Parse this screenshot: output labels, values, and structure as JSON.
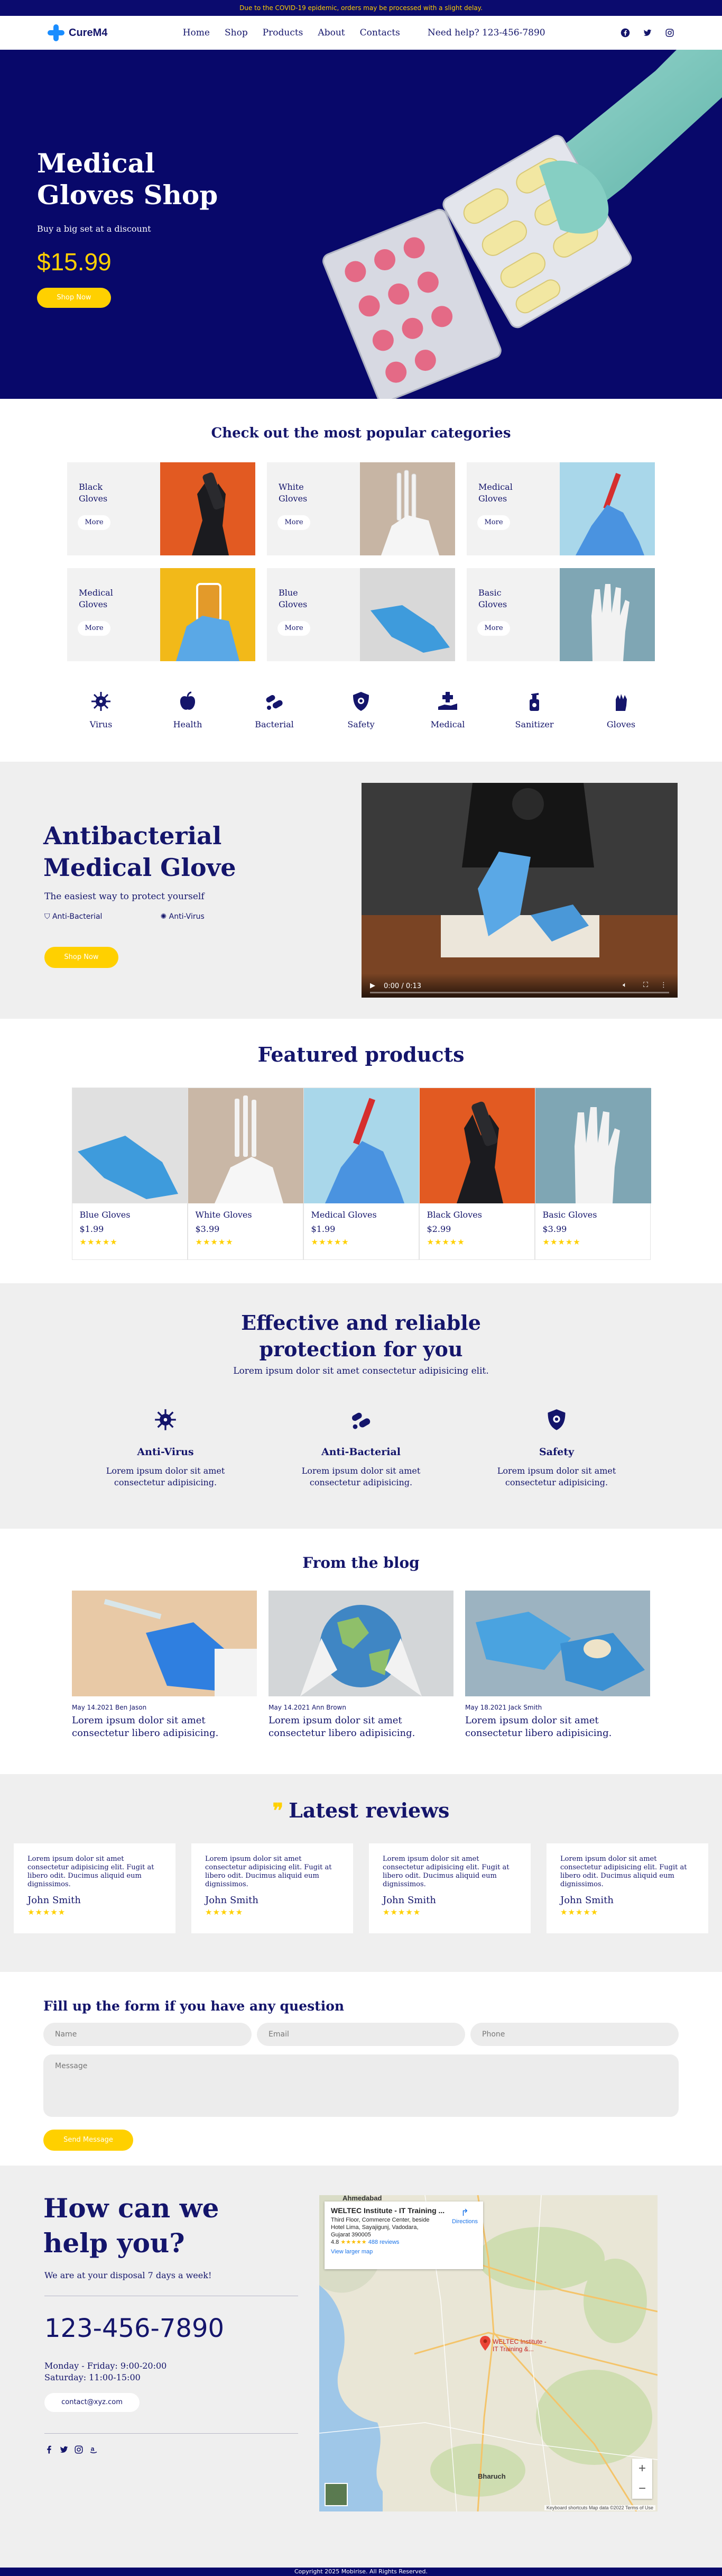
{
  "topbar": {
    "notice": "Due to the COVID-19 epidemic, orders may be processed with a slight delay."
  },
  "nav": {
    "logo": "CureM4",
    "items": [
      "Home",
      "Shop",
      "Products",
      "About",
      "Contacts"
    ],
    "phone": "Need help? 123-456-7890",
    "social_icons": [
      "facebook-icon",
      "twitter-icon",
      "instagram-icon"
    ]
  },
  "hero": {
    "title_line1": "Medical",
    "title_line2": "Gloves Shop",
    "subtitle": "Buy a big set at a discount",
    "price": "$15.99",
    "button": "Shop Now"
  },
  "categories": {
    "title": "Check out the most popular categories",
    "more_label": "More",
    "items": [
      {
        "line1": "Black",
        "line2": "Gloves"
      },
      {
        "line1": "White",
        "line2": "Gloves"
      },
      {
        "line1": "Medical",
        "line2": "Gloves"
      },
      {
        "line1": "Medical",
        "line2": "Gloves"
      },
      {
        "line1": "Blue",
        "line2": "Gloves"
      },
      {
        "line1": "Basic",
        "line2": "Gloves"
      }
    ],
    "icons": [
      {
        "label": "Virus",
        "icon": "virus-icon"
      },
      {
        "label": "Health",
        "icon": "apple-icon"
      },
      {
        "label": "Bacterial",
        "icon": "bacteria-icon"
      },
      {
        "label": "Safety",
        "icon": "shield-virus-icon"
      },
      {
        "label": "Medical",
        "icon": "hand-medical-icon"
      },
      {
        "label": "Sanitizer",
        "icon": "sanitizer-icon"
      },
      {
        "label": "Gloves",
        "icon": "glove-icon"
      }
    ]
  },
  "antibacterial": {
    "title_line1": "Antibacterial",
    "title_line2": "Medical Glove",
    "subtitle": "The easiest way to protect yourself",
    "feature1": "Anti-Bacterial",
    "feature2": "Anti-Virus",
    "button": "Shop Now",
    "video_time": "0:00 / 0:13"
  },
  "featured": {
    "title": "Featured products",
    "products": [
      {
        "name": "Blue Gloves",
        "price": "$1.99",
        "stars": "★★★★★"
      },
      {
        "name": "White Gloves",
        "price": "$3.99",
        "stars": "★★★★★"
      },
      {
        "name": "Medical Gloves",
        "price": "$1.99",
        "stars": "★★★★★"
      },
      {
        "name": "Black Gloves",
        "price": "$2.99",
        "stars": "★★★★★"
      },
      {
        "name": "Basic Gloves",
        "price": "$3.99",
        "stars": "★★★★★"
      }
    ]
  },
  "effective": {
    "title_line1": "Effective and reliable",
    "title_line2": "protection for you",
    "lead": "Lorem ipsum dolor sit amet consectetur adipisicing elit.",
    "items": [
      {
        "title": "Anti-Virus",
        "text": "Lorem ipsum dolor sit amet consectetur adipisicing."
      },
      {
        "title": "Anti-Bacterial",
        "text": "Lorem ipsum dolor sit amet consectetur adipisicing."
      },
      {
        "title": "Safety",
        "text": "Lorem ipsum dolor sit amet consectetur adipisicing."
      }
    ]
  },
  "blog": {
    "title": "From the blog",
    "posts": [
      {
        "meta": "May 14.2021 Ben Jason",
        "text": "Lorem ipsum dolor sit amet consectetur libero adipisicing."
      },
      {
        "meta": "May 14.2021 Ann Brown",
        "text": "Lorem ipsum dolor sit amet consectetur libero adipisicing."
      },
      {
        "meta": "May 18.2021 Jack Smith",
        "text": "Lorem ipsum dolor sit amet consectetur libero adipisicing."
      }
    ]
  },
  "reviews": {
    "quote_mark": "❞",
    "title": "Latest reviews",
    "items": [
      {
        "text": "Lorem ipsum dolor sit amet consectetur adipisicing elit. Fugit at libero odit. Ducimus aliquid eum dignissimos.",
        "name": "John Smith",
        "stars": "★★★★★"
      },
      {
        "text": "Lorem ipsum dolor sit amet consectetur adipisicing elit. Fugit at libero odit. Ducimus aliquid eum dignissimos.",
        "name": "John Smith",
        "stars": "★★★★★"
      },
      {
        "text": "Lorem ipsum dolor sit amet consectetur adipisicing elit. Fugit at libero odit. Ducimus aliquid eum dignissimos.",
        "name": "John Smith",
        "stars": "★★★★★"
      },
      {
        "text": "Lorem ipsum dolor sit amet consectetur adipisicing elit. Fugit at libero odit. Ducimus aliquid eum dignissimos.",
        "name": "John Smith",
        "stars": "★★★★★"
      }
    ]
  },
  "form": {
    "title": "Fill up the form if you have any question",
    "name_placeholder": "Name",
    "email_placeholder": "Email",
    "phone_placeholder": "Phone",
    "message_placeholder": "Message",
    "button": "Send Message"
  },
  "contact": {
    "title_line1": "How can we",
    "title_line2": "help you?",
    "availability": "We are at your disposal 7 days a week!",
    "phone": "123-456-7890",
    "hours_line1": "Monday - Friday: 9:00-20:00",
    "hours_line2": "Saturday: 11:00-15:00",
    "email": "contact@xyz.com",
    "social_icons": [
      "facebook-icon",
      "twitter-icon",
      "instagram-icon",
      "amazon-icon"
    ],
    "map": {
      "place_name": "WELTEC Institute - IT Training ...",
      "address_line1": "Third Floor, Commerce Center, beside",
      "address_line2": "Hotel Lima, Sayajigunj, Vadodara,",
      "address_line3": "Gujarat 390005",
      "rating": "4.8",
      "stars": "★★★★★",
      "reviews": "488 reviews",
      "directions": "Directions",
      "larger_map": "View larger map",
      "city_top": "Ahmedabad",
      "city_pin": "WELTEC Institute - IT Training &...",
      "city_bottom": "Bharuch",
      "attribution": "Keyboard shortcuts   Map data ©2022   Terms of Use"
    }
  },
  "footer": {
    "copyright": "Copyright 2025 Mobirise. All Rights Reserved."
  },
  "colors": {
    "navy": "#08086a",
    "accent_yellow": "#ffd000",
    "text": "#14156b",
    "glove_blue": "#4aa3e0"
  }
}
